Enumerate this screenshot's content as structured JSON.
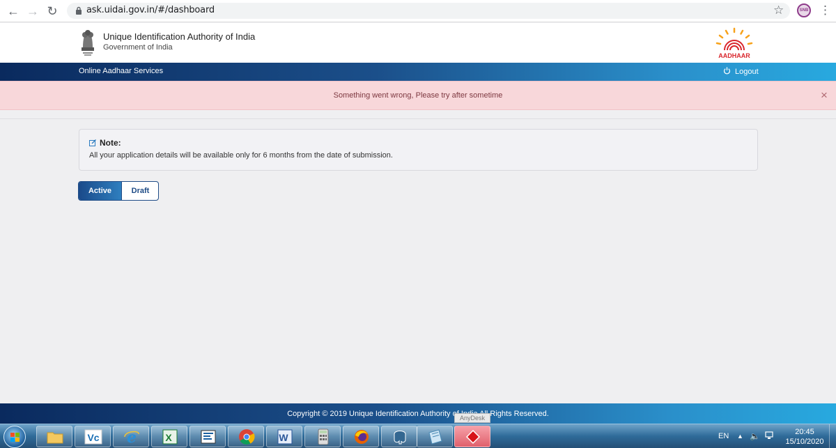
{
  "browser": {
    "url": "ask.uidai.gov.in/#/dashboard",
    "profile_initials": "SNB"
  },
  "header": {
    "org_name": "Unique Identification Authority of India",
    "org_sub": "Government of India",
    "logo_text": "AADHAAR"
  },
  "nav": {
    "title": "Online Aadhaar Services",
    "logout_label": "Logout"
  },
  "alert": {
    "message": "Something went wrong, Please try after sometime",
    "close_glyph": "×"
  },
  "note": {
    "heading": "Note:",
    "body": "All your application details will be available only for 6 months from the date of submission."
  },
  "tabs": {
    "active_label": "Active",
    "draft_label": "Draft"
  },
  "footer": {
    "copyright": "Copyright © 2019 Unique Identification Authority of India All Rights Reserved."
  },
  "taskbar": {
    "tooltip": "AnyDesk",
    "apps": [
      "file-explorer",
      "vnc-viewer",
      "internet-explorer",
      "excel",
      "app-tool",
      "chrome",
      "word",
      "calculator",
      "firefox",
      "postgresql",
      "notepad-app",
      "anydesk"
    ],
    "language": "EN",
    "time": "20:45",
    "date": "15/10/2020"
  },
  "colors": {
    "nav_start": "#0a2a5e",
    "nav_end": "#28a9df",
    "alert_bg": "#f8d7da",
    "alert_text": "#7d3840",
    "aadhaar_orange": "#f7a21b",
    "aadhaar_red": "#d9262c"
  }
}
